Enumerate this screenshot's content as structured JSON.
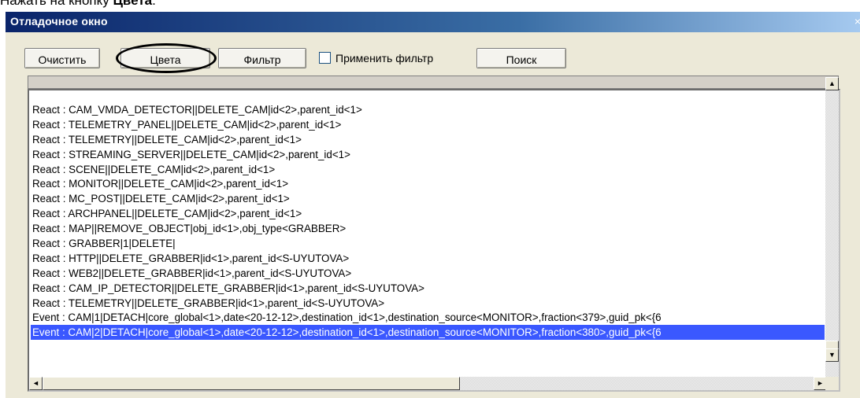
{
  "caption": {
    "prefix": "Нажать на кнопку ",
    "bold": "Цвета",
    "suffix": "."
  },
  "window": {
    "title": "Отладочное окно",
    "close_glyph": "×"
  },
  "toolbar": {
    "clear_label": "Очистить",
    "colors_label": "Цвета",
    "filter_label": "Фильтр",
    "apply_filter_label": "Применить фильтр",
    "apply_filter_checked": false,
    "search_label": "Поиск"
  },
  "log": {
    "rows": [
      "React : CAM_VMDA_DETECTOR||DELETE_CAM|id<2>,parent_id<1>",
      "React : TELEMETRY_PANEL||DELETE_CAM|id<2>,parent_id<1>",
      "React : TELEMETRY||DELETE_CAM|id<2>,parent_id<1>",
      "React : STREAMING_SERVER||DELETE_CAM|id<2>,parent_id<1>",
      "React : SCENE||DELETE_CAM|id<2>,parent_id<1>",
      "React : MONITOR||DELETE_CAM|id<2>,parent_id<1>",
      "React : MC_POST||DELETE_CAM|id<2>,parent_id<1>",
      "React : ARCHPANEL||DELETE_CAM|id<2>,parent_id<1>",
      "React : MAP||REMOVE_OBJECT|obj_id<1>,obj_type<GRABBER>",
      "React : GRABBER|1|DELETE|",
      "React : HTTP||DELETE_GRABBER|id<1>,parent_id<S-UYUTOVA>",
      "React : WEB2||DELETE_GRABBER|id<1>,parent_id<S-UYUTOVA>",
      "React : CAM_IP_DETECTOR||DELETE_GRABBER|id<1>,parent_id<S-UYUTOVA>",
      "React : TELEMETRY||DELETE_GRABBER|id<1>,parent_id<S-UYUTOVA>",
      "Event : CAM|1|DETACH|core_global<1>,date<20-12-12>,destination_id<1>,destination_source<MONITOR>,fraction<379>,guid_pk<{6",
      "Event : CAM|2|DETACH|core_global<1>,date<20-12-12>,destination_id<1>,destination_source<MONITOR>,fraction<380>,guid_pk<{6"
    ],
    "selected_index": 15
  },
  "scrollbar": {
    "up_glyph": "▲",
    "down_glyph": "▼",
    "left_glyph": "◄",
    "right_glyph": "►"
  }
}
